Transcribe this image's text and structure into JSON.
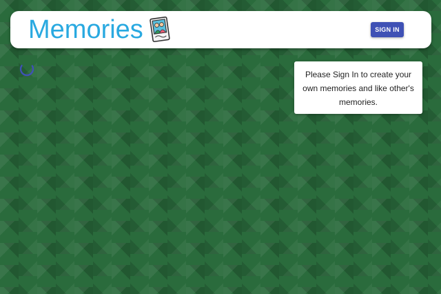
{
  "header": {
    "title": "Memories",
    "logo_icon": "photo-memories-icon",
    "signin_label": "SIGN IN"
  },
  "loading": {
    "icon": "loading-spinner-icon"
  },
  "notice": {
    "text": "Please Sign In to create your own memories and like other's memories."
  },
  "colors": {
    "background": "#2a6b3c",
    "title": "#29a9e0",
    "button": "#3f51b5"
  }
}
